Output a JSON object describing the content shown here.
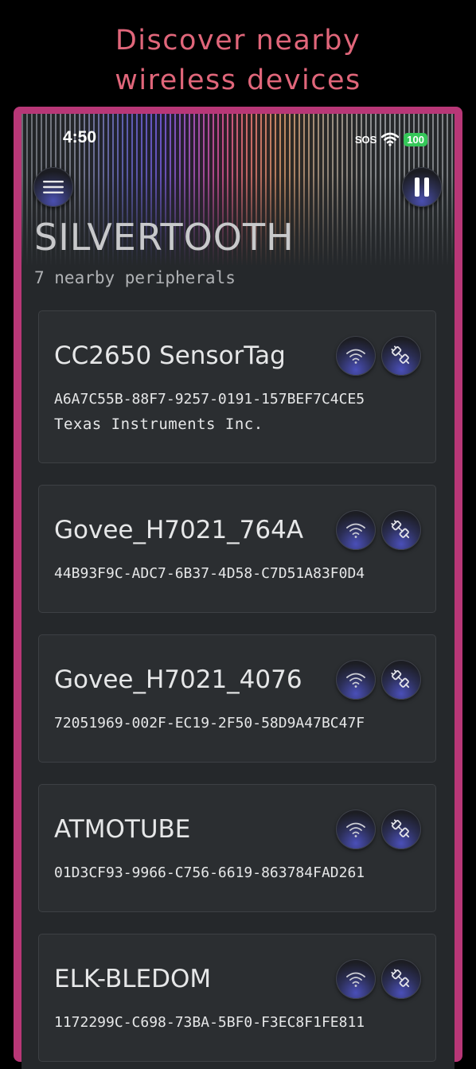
{
  "promo": {
    "line1": "Discover nearby",
    "line2": "wireless devices"
  },
  "status_bar": {
    "time": "4:50",
    "sos": "SOS",
    "battery": "100"
  },
  "app": {
    "title": "SILVERTOOTH",
    "subtitle": "7 nearby peripherals"
  },
  "devices": [
    {
      "name": "CC2650 SensorTag",
      "uuid": "A6A7C55B-88F7-9257-0191-157BEF7C4CE5",
      "vendor": "Texas Instruments Inc."
    },
    {
      "name": "Govee_H7021_764A",
      "uuid": "44B93F9C-ADC7-6B37-4D58-C7D51A83F0D4",
      "vendor": ""
    },
    {
      "name": "Govee_H7021_4076",
      "uuid": "72051969-002F-EC19-2F50-58D9A47BC47F",
      "vendor": ""
    },
    {
      "name": "ATMOTUBE",
      "uuid": "01D3CF93-9966-C756-6619-863784FAD261",
      "vendor": ""
    },
    {
      "name": "ELK-BLEDOM",
      "uuid": "1172299C-C698-73BA-5BF0-F3EC8F1FE811",
      "vendor": ""
    }
  ],
  "icons": {
    "menu": "hamburger-icon",
    "pause": "pause-icon",
    "signal": "wifi-signal-icon",
    "connect": "plug-connect-icon"
  },
  "colors": {
    "accent": "#b83777",
    "promo_text": "#e0667a",
    "background": "#25282b",
    "card": "#2b2e31",
    "button_glow": "#4a4fb8"
  }
}
